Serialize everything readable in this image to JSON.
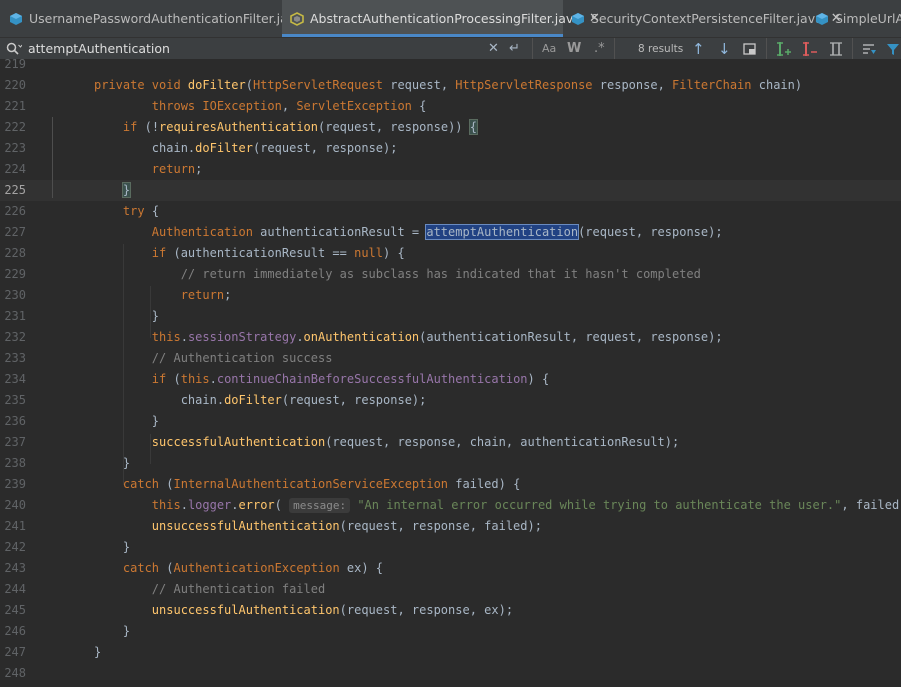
{
  "tabs": [
    {
      "label": "UsernamePasswordAuthenticationFilter.java",
      "active": false,
      "closable": true,
      "icon": "java-class-icon"
    },
    {
      "label": "AbstractAuthenticationProcessingFilter.java",
      "active": true,
      "closable": true,
      "icon": "abstract-class-icon"
    },
    {
      "label": "SecurityContextPersistenceFilter.java",
      "active": false,
      "closable": true,
      "icon": "java-class-icon"
    },
    {
      "label": "SimpleUrlAut",
      "active": false,
      "closable": false,
      "icon": "java-class-icon"
    }
  ],
  "search": {
    "query": "attemptAuthentication",
    "match_case_label": "Aa",
    "words_label": "W",
    "regex_label": ".*",
    "results": "8 results"
  },
  "editor": {
    "current_line": "225",
    "lines": [
      {
        "n": "219",
        "html": ""
      },
      {
        "n": "220",
        "html": "<span class=\"kw\">private void </span><span class=\"fn\">doFilter</span>(<span class=\"ty\">HttpServletRequest</span> <span class=\"prm\">request</span>, <span class=\"ty\">HttpServletResponse</span> <span class=\"prm\">response</span>, <span class=\"ty\">FilterChain</span> <span class=\"prm\">chain</span>)"
      },
      {
        "n": "221",
        "html": "        <span class=\"kw\">throws </span><span class=\"ty\">IOException</span>, <span class=\"ty\">ServletException</span> {"
      },
      {
        "n": "222",
        "html": "    <span class=\"kw\">if </span>(!<span class=\"mc\">requiresAuthentication</span>(<span class=\"prm\">request</span>, <span class=\"prm\">response</span>)) <span class=\"brace-hl\">{</span>"
      },
      {
        "n": "223",
        "html": "        <span class=\"prm\">chain</span>.<span class=\"mc\">doFilter</span>(<span class=\"prm\">request</span>, <span class=\"prm\">response</span>);"
      },
      {
        "n": "224",
        "html": "        <span class=\"kw\">return</span>;"
      },
      {
        "n": "225",
        "html": "    <span class=\"brace-hl\">}</span>"
      },
      {
        "n": "226",
        "html": "    <span class=\"kw\">try </span>{"
      },
      {
        "n": "227",
        "html": "        <span class=\"ty\">Authentication</span> authenticationResult = <span class=\"hit\">attemptAuthentication</span>(<span class=\"prm\">request</span>, <span class=\"prm\">response</span>);"
      },
      {
        "n": "228",
        "html": "        <span class=\"kw\">if </span>(authenticationResult == <span class=\"kw\">null</span>) {"
      },
      {
        "n": "229",
        "html": "            <span class=\"cm\">// return immediately as subclass has indicated that it hasn't completed</span>"
      },
      {
        "n": "230",
        "html": "            <span class=\"kw\">return</span>;"
      },
      {
        "n": "231",
        "html": "        }"
      },
      {
        "n": "232",
        "html": "        <span class=\"kw\">this</span>.<span class=\"fld\">sessionStrategy</span>.<span class=\"mc\">onAuthentication</span>(authenticationResult, <span class=\"prm\">request</span>, <span class=\"prm\">response</span>);"
      },
      {
        "n": "233",
        "html": "        <span class=\"cm\">// Authentication success</span>"
      },
      {
        "n": "234",
        "html": "        <span class=\"kw\">if </span>(<span class=\"kw\">this</span>.<span class=\"fld\">continueChainBeforeSuccessfulAuthentication</span>) {"
      },
      {
        "n": "235",
        "html": "            <span class=\"prm\">chain</span>.<span class=\"mc\">doFilter</span>(<span class=\"prm\">request</span>, <span class=\"prm\">response</span>);"
      },
      {
        "n": "236",
        "html": "        }"
      },
      {
        "n": "237",
        "html": "        <span class=\"mc\">successfulAuthentication</span>(<span class=\"prm\">request</span>, <span class=\"prm\">response</span>, <span class=\"prm\">chain</span>, authenticationResult);"
      },
      {
        "n": "238",
        "html": "    }"
      },
      {
        "n": "239",
        "html": "    <span class=\"kw\">catch </span>(<span class=\"ty\">InternalAuthenticationServiceException</span> failed) {"
      },
      {
        "n": "240",
        "html": "        <span class=\"kw\">this</span>.<span class=\"fld\">logger</span>.<span class=\"mc\">error</span>( <span class=\"hint\">message:</span> <span class=\"str\">\"An internal error occurred while trying to authenticate the user.\"</span>, failed);"
      },
      {
        "n": "241",
        "html": "        <span class=\"mc\">unsuccessfulAuthentication</span>(<span class=\"prm\">request</span>, <span class=\"prm\">response</span>, failed);"
      },
      {
        "n": "242",
        "html": "    }"
      },
      {
        "n": "243",
        "html": "    <span class=\"kw\">catch </span>(<span class=\"ty\">AuthenticationException</span> ex) {"
      },
      {
        "n": "244",
        "html": "        <span class=\"cm\">// Authentication failed</span>"
      },
      {
        "n": "245",
        "html": "        <span class=\"mc\">unsuccessfulAuthentication</span>(<span class=\"prm\">request</span>, <span class=\"prm\">response</span>, ex);"
      },
      {
        "n": "246",
        "html": "    }"
      },
      {
        "n": "247",
        "html": "}"
      },
      {
        "n": "248",
        "html": ""
      }
    ]
  },
  "colors": {
    "accent": "#4a88c7",
    "keyword": "#cc7832",
    "method": "#ffc66d",
    "field": "#9876aa",
    "string": "#6a8759",
    "comment": "#808080"
  }
}
